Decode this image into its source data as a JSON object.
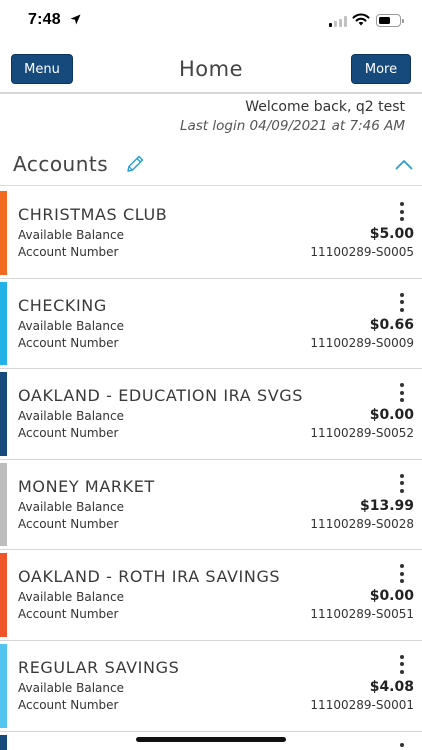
{
  "status_bar": {
    "time": "7:48",
    "icons": [
      "location-arrow-icon",
      "cellular-signal-icon",
      "wifi-icon",
      "battery-icon"
    ]
  },
  "header": {
    "menu_label": "Menu",
    "title": "Home",
    "more_label": "More",
    "accent_color": "#174a7c"
  },
  "welcome": {
    "text": "Welcome back, q2 test",
    "last_login": "Last login 04/09/2021 at 7:46 AM"
  },
  "accounts": {
    "title": "Accounts",
    "edit_icon": "pencil-icon",
    "collapse_icon": "chevron-up-icon",
    "balance_label": "Available Balance",
    "number_label": "Account Number",
    "items": [
      {
        "name": "CHRISTMAS CLUB",
        "balance": "$5.00",
        "number": "11100289-S0005",
        "color": "#f26a21"
      },
      {
        "name": "CHECKING",
        "balance": "$0.66",
        "number": "11100289-S0009",
        "color": "#23b2e7"
      },
      {
        "name": "OAKLAND - EDUCATION IRA SVGS",
        "balance": "$0.00",
        "number": "11100289-S0052",
        "color": "#174a7c"
      },
      {
        "name": "MONEY MARKET",
        "balance": "$13.99",
        "number": "11100289-S0028",
        "color": "#bdbdbd"
      },
      {
        "name": "OAKLAND - ROTH IRA SAVINGS",
        "balance": "$0.00",
        "number": "11100289-S0051",
        "color": "#f0552a"
      },
      {
        "name": "REGULAR SAVINGS",
        "balance": "$4.08",
        "number": "11100289-S0001",
        "color": "#52c4ef"
      }
    ],
    "peek_color": "#174a7c"
  }
}
